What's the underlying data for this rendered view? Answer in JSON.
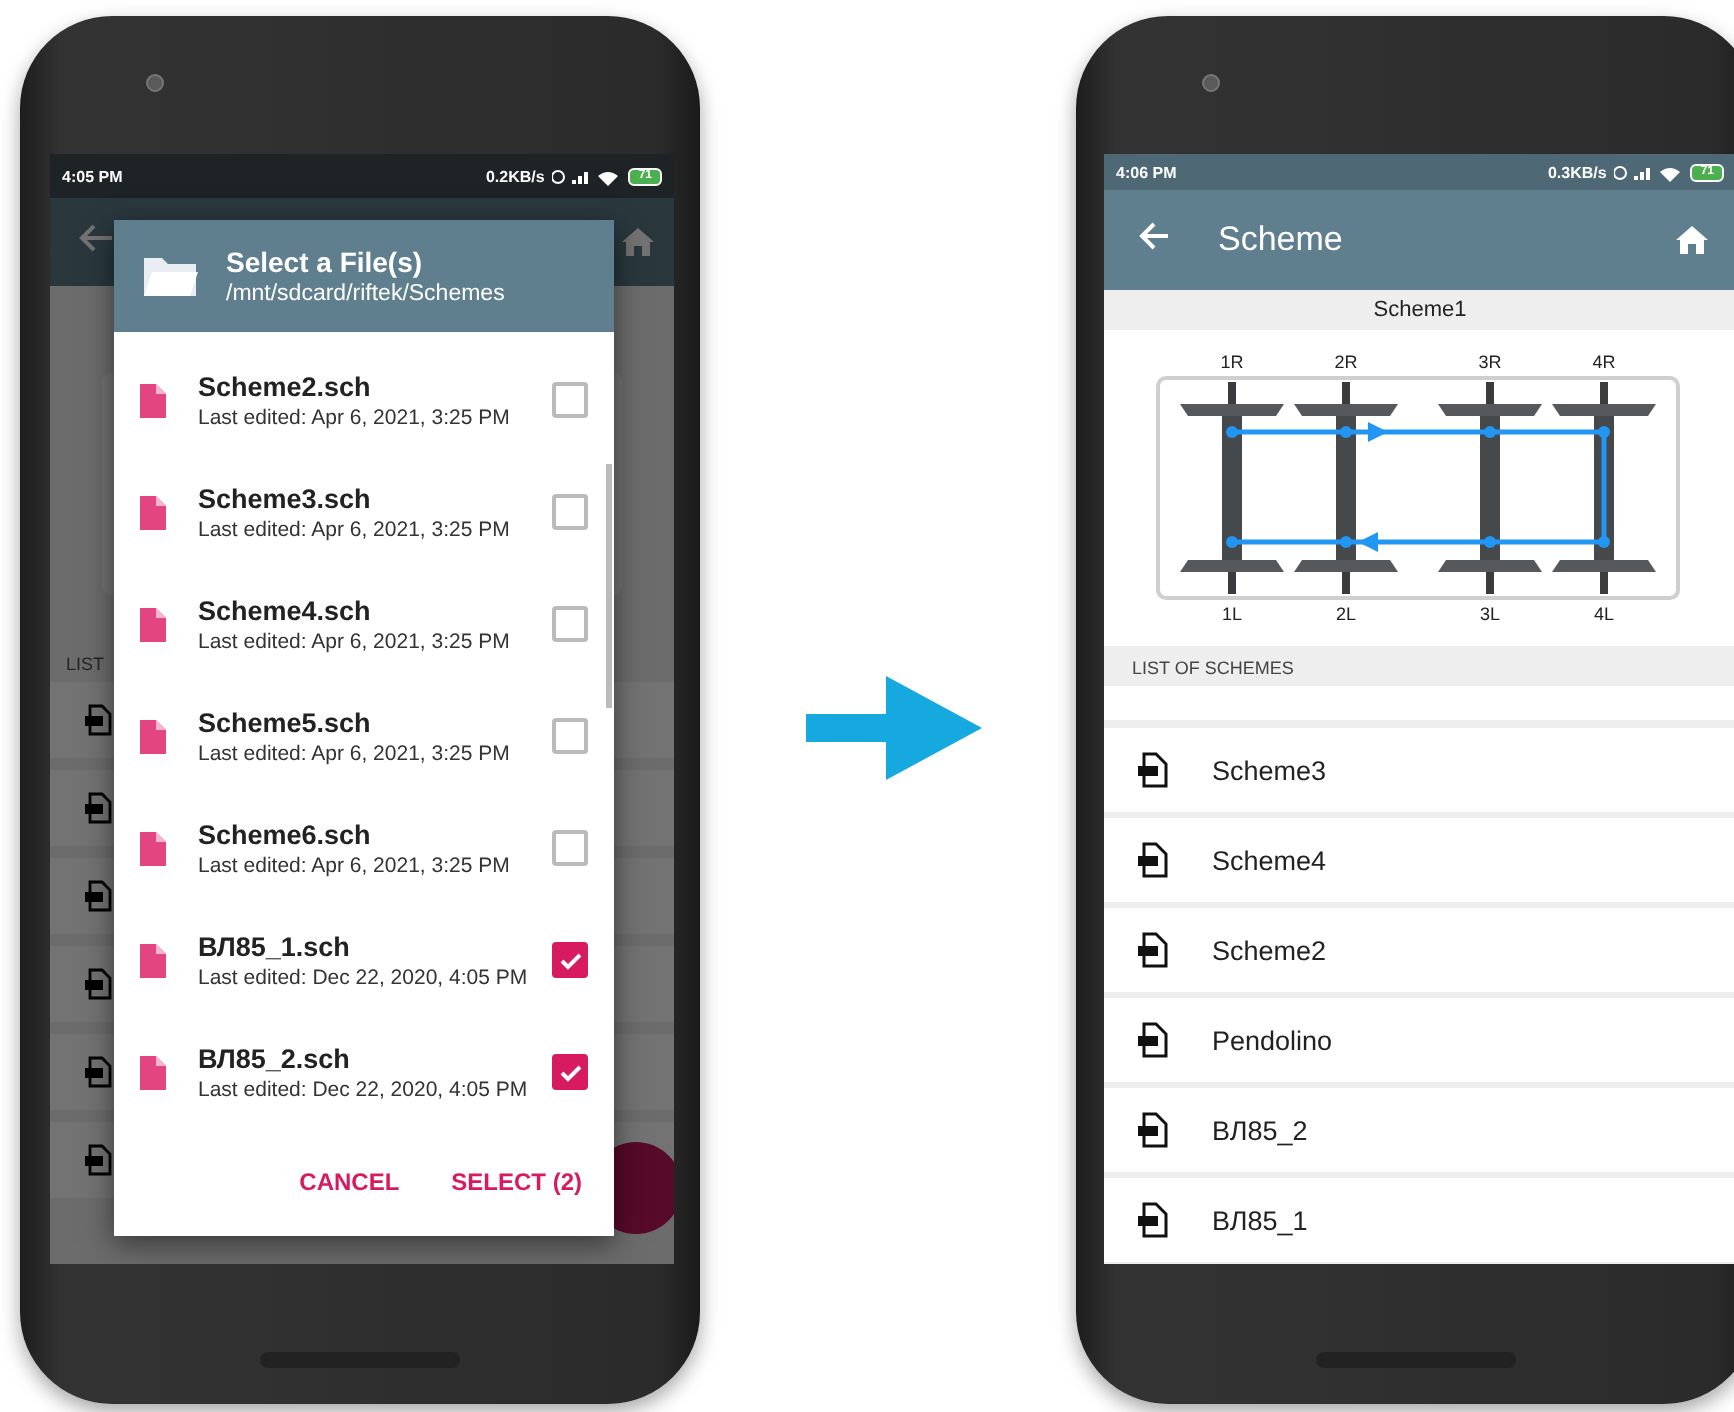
{
  "left_screen": {
    "status_bar": {
      "time": "4:05 PM",
      "speed": "0.2KB/s",
      "battery": "71"
    },
    "background_list_header": "LIST",
    "dialog": {
      "title": "Select a File(s)",
      "path": "/mnt/sdcard/riftek/Schemes",
      "files": [
        {
          "name": "Scheme2.sch",
          "edited": "Last edited: Apr 6, 2021, 3:25 PM",
          "checked": false
        },
        {
          "name": "Scheme3.sch",
          "edited": "Last edited: Apr 6, 2021, 3:25 PM",
          "checked": false
        },
        {
          "name": "Scheme4.sch",
          "edited": "Last edited: Apr 6, 2021, 3:25 PM",
          "checked": false
        },
        {
          "name": "Scheme5.sch",
          "edited": "Last edited: Apr 6, 2021, 3:25 PM",
          "checked": false
        },
        {
          "name": "Scheme6.sch",
          "edited": "Last edited: Apr 6, 2021, 3:25 PM",
          "checked": false
        },
        {
          "name": "ВЛ85_1.sch",
          "edited": "Last edited: Dec 22, 2020, 4:05 PM",
          "checked": true
        },
        {
          "name": "ВЛ85_2.sch",
          "edited": "Last edited: Dec 22, 2020, 4:05 PM",
          "checked": true
        }
      ],
      "buttons": [
        "CANCEL",
        "SELECT (2)"
      ]
    }
  },
  "right_screen": {
    "status_bar": {
      "time": "4:06 PM",
      "speed": "0.3KB/s",
      "battery": "71"
    },
    "app_bar": {
      "title": "Scheme"
    },
    "scheme_name": "Scheme1",
    "diagram": {
      "top_labels": [
        "1R",
        "2R",
        "3R",
        "4R"
      ],
      "bottom_labels": [
        "1L",
        "2L",
        "3L",
        "4L"
      ]
    },
    "list_header": "LIST OF SCHEMES",
    "schemes": [
      "Scheme3",
      "Scheme4",
      "Scheme2",
      "Pendolino",
      "ВЛ85_2",
      "ВЛ85_1"
    ]
  }
}
